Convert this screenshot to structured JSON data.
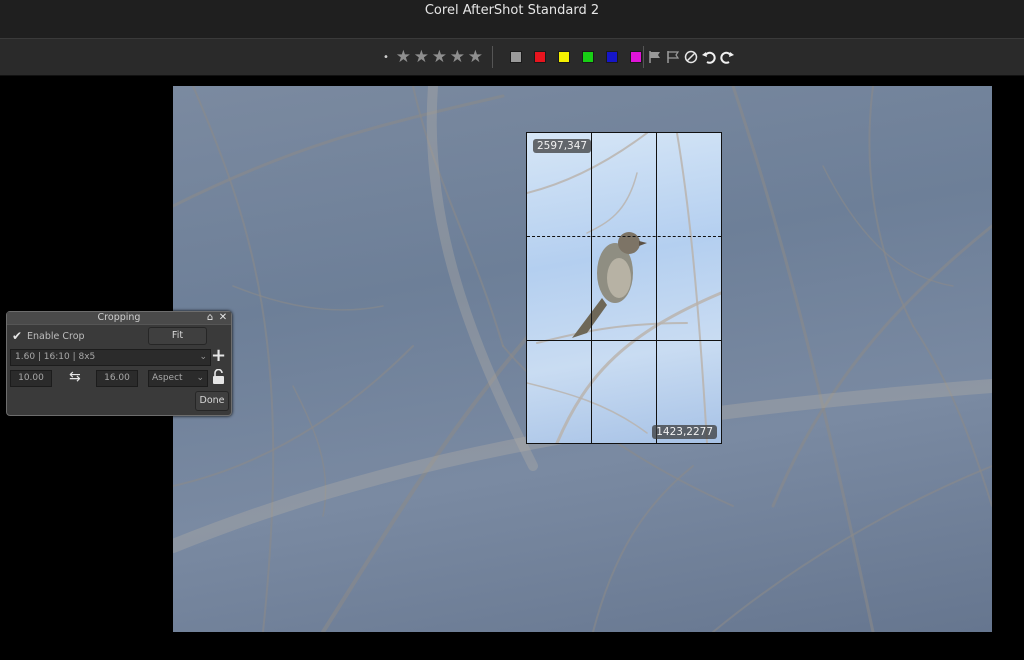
{
  "app": {
    "title": "Corel AfterShot Standard 2"
  },
  "toolbar": {
    "rating_dot": "•",
    "stars": [
      "star-1",
      "star-2",
      "star-3",
      "star-4",
      "star-5"
    ],
    "color_labels": [
      {
        "name": "gray",
        "color": "#9a9a9a"
      },
      {
        "name": "red",
        "color": "#e8141e"
      },
      {
        "name": "yellow",
        "color": "#f4f000"
      },
      {
        "name": "green",
        "color": "#18d015"
      },
      {
        "name": "blue",
        "color": "#1616c8"
      },
      {
        "name": "magenta",
        "color": "#e014d8"
      }
    ],
    "icons": [
      "flag-pick-icon",
      "flag-reject-icon",
      "clear-flag-icon",
      "rotate-left-icon",
      "rotate-right-icon"
    ]
  },
  "crop_overlay": {
    "top_left_coords": "2597,347",
    "bottom_right_coords": "1423,2277"
  },
  "cropping_panel": {
    "title": "Cropping",
    "enable_crop_label": "Enable Crop",
    "enable_crop_checked": true,
    "fit_label": "Fit",
    "preset_value": "1.60 | 16:10 | 8x5",
    "width_value": "10.00",
    "height_value": "16.00",
    "mode_value": "Aspect",
    "done_label": "Done"
  }
}
